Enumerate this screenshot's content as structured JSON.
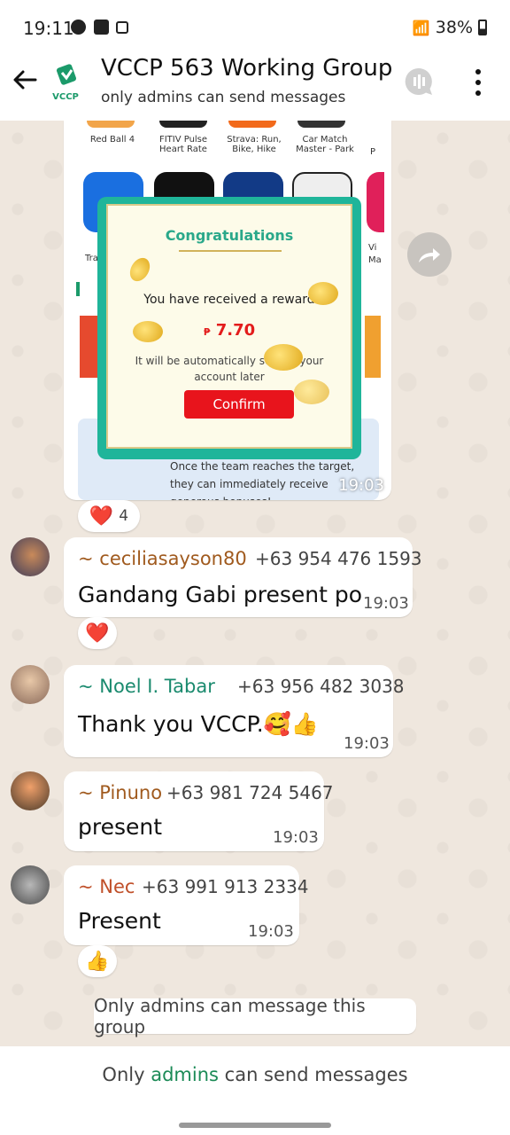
{
  "status_bar": {
    "time": "19:11",
    "battery": "38%"
  },
  "header": {
    "title": "VCCP 563 Working Group",
    "subtitle": "only admins can send messages",
    "logo_text": "VCCP"
  },
  "image_message": {
    "app_labels": [
      "Red Ball 4",
      "FITIV Pulse Heart Rate",
      "Strava: Run, Bike, Hike",
      "Car Match Master - Park"
    ],
    "side_labels": [
      "Tra",
      "Vi",
      "Ma",
      "P"
    ],
    "reward_popup": {
      "title": "Congratulations",
      "received_text": "You have received a reward",
      "currency": "₱",
      "amount": "7.70",
      "auto_text": "It will be automatically sent to your account later",
      "confirm_label": "Confirm"
    },
    "banner_text": "Once the team reaches the target, they can immediately receive generous bonuses!",
    "time": "19:03",
    "reaction": "❤️",
    "reaction_count": "4"
  },
  "messages": [
    {
      "sender": "~ ceciliasayson80",
      "phone": "+63 954 476 1593",
      "text": "Gandang Gabi present po",
      "time": "19:03",
      "reaction": "❤️",
      "sender_color": "#a05a1e"
    },
    {
      "sender": "~ Noel I. Tabar",
      "phone": "+63 956 482 3038",
      "text": "Thank you VCCP.🥰👍",
      "time": "19:03",
      "sender_color": "#1a8a6e"
    },
    {
      "sender": "~ Pinuno",
      "phone": "+63 981 724 5467",
      "text": "present",
      "time": "19:03",
      "sender_color": "#a05a1e"
    },
    {
      "sender": "~ Nec",
      "phone": "+63 991 913 2334",
      "text": "Present",
      "time": "19:03",
      "reaction": "👍",
      "sender_color": "#c0502a"
    }
  ],
  "notice": "Only admins can message this group",
  "footer": {
    "prefix": "Only",
    "link": "admins",
    "suffix": "can send messages"
  }
}
